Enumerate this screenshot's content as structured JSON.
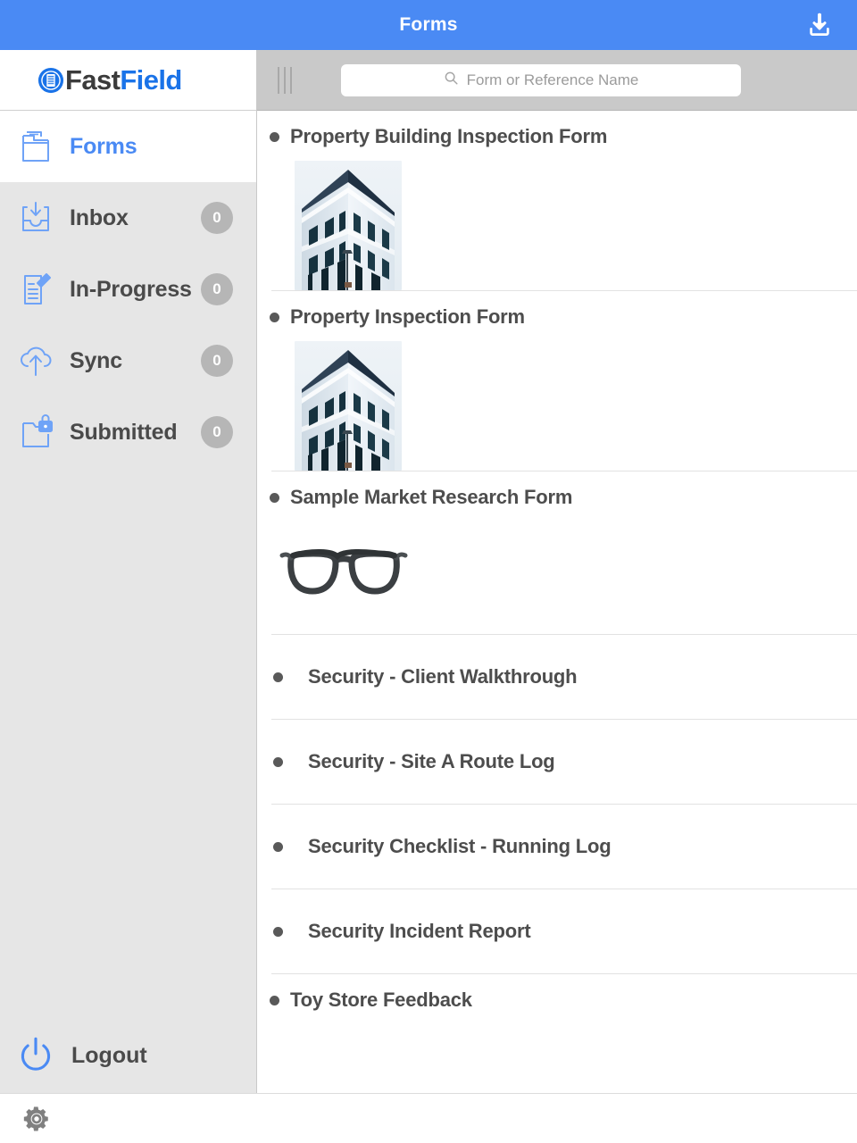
{
  "header": {
    "title": "Forms",
    "download_icon": "download-icon",
    "background_color": "#4a8af4"
  },
  "brand": {
    "logo_icon": "fastfield-logo-icon",
    "name_part1": "Fast",
    "name_part2": "Field",
    "accent_color": "#1a73e8"
  },
  "sidebar": {
    "items": [
      {
        "label": "Forms",
        "icon": "folder-forms-icon",
        "badge": null,
        "active": true
      },
      {
        "label": "Inbox",
        "icon": "inbox-tray-icon",
        "badge": "0",
        "active": false
      },
      {
        "label": "In-Progress",
        "icon": "document-pencil-icon",
        "badge": "0",
        "active": false
      },
      {
        "label": "Sync",
        "icon": "cloud-upload-icon",
        "badge": "0",
        "active": false
      },
      {
        "label": "Submitted",
        "icon": "folder-lock-icon",
        "badge": "0",
        "active": false
      }
    ],
    "logout": {
      "label": "Logout",
      "icon": "power-icon"
    }
  },
  "search": {
    "placeholder": "Form or Reference Name",
    "value": "",
    "icon": "search-icon",
    "grip_icon": "drag-grip-icon"
  },
  "forms": [
    {
      "title": "Property Building Inspection Form",
      "thumbnail": "building-photo",
      "indent": false
    },
    {
      "title": "Property Inspection Form",
      "thumbnail": "building-photo",
      "indent": false
    },
    {
      "title": "Sample Market Research Form",
      "thumbnail": "eyeglasses-photo",
      "indent": false
    },
    {
      "title": "Security - Client Walkthrough",
      "thumbnail": null,
      "indent": true
    },
    {
      "title": "Security - Site A Route Log",
      "thumbnail": null,
      "indent": true
    },
    {
      "title": "Security Checklist - Running Log",
      "thumbnail": null,
      "indent": true
    },
    {
      "title": "Security Incident Report",
      "thumbnail": null,
      "indent": true
    },
    {
      "title": "Toy Store Feedback",
      "thumbnail": null,
      "indent": false
    }
  ],
  "bottombar": {
    "settings_icon": "gear-icon"
  }
}
